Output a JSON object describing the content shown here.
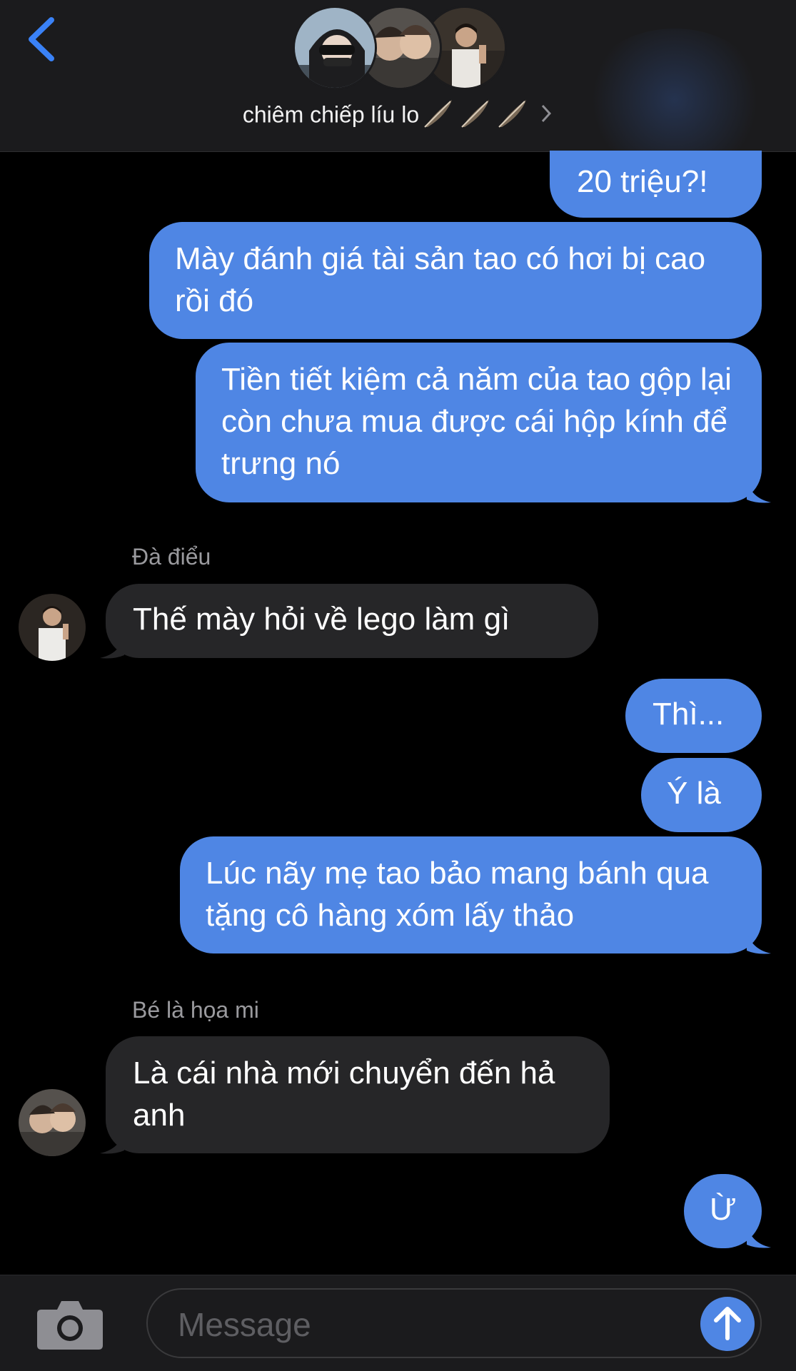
{
  "header": {
    "group_name": "chiêm chiếp líu lo",
    "feather_emoji": "🪶🪶🪶",
    "icons": {
      "back": "chevron-left-icon",
      "details": "chevron-right-icon"
    },
    "colors": {
      "accent": "#3a82f7",
      "header_bg": "#1b1b1d"
    }
  },
  "messages": [
    {
      "direction": "out",
      "text": "20 triệu?!"
    },
    {
      "direction": "out",
      "text": "Mày đánh giá tài sản tao có hơi bị cao rồi đó"
    },
    {
      "direction": "out",
      "text": "Tiền tiết kiệm cả năm của tao gộp lại còn chưa mua được cái hộp kính để trưng nó"
    },
    {
      "direction": "in",
      "sender": "Đà điểu",
      "text": "Thế mày hỏi về lego làm gì"
    },
    {
      "direction": "out",
      "text": "Thì..."
    },
    {
      "direction": "out",
      "text": "Ý là"
    },
    {
      "direction": "out",
      "text": "Lúc nãy mẹ tao bảo mang bánh qua tặng cô hàng xóm lấy thảo"
    },
    {
      "direction": "in",
      "sender": "Bé là họa mi",
      "text": "Là cái nhà mới chuyển đến hả anh"
    },
    {
      "direction": "out",
      "text": "Ừ"
    }
  ],
  "composer": {
    "placeholder": "Message",
    "icons": {
      "camera": "camera-icon",
      "send": "arrow-up-icon"
    }
  },
  "colors": {
    "outgoing_bubble": "#4f86e4",
    "incoming_bubble": "#262628",
    "background": "#000000"
  }
}
